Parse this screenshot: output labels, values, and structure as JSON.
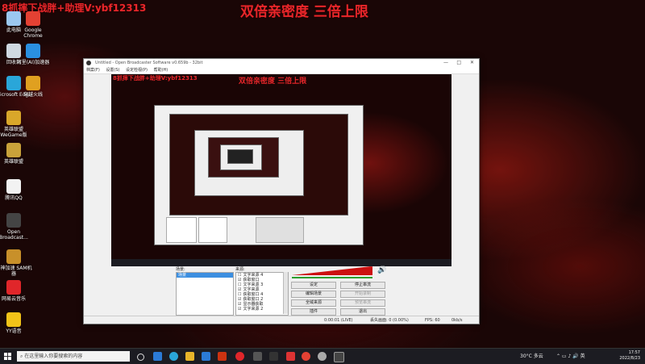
{
  "overlay": {
    "top_left": "8抓摔下战胖+助理V:ybf12313",
    "top_center": "双倍亲密度 三倍上限"
  },
  "desktop_icons": [
    {
      "label": "此电脑",
      "icon": "computer-icon",
      "color": "#9bc8f0"
    },
    {
      "label": "Google Chrome",
      "icon": "chrome-icon",
      "color": "#e34133"
    },
    {
      "label": "回收站",
      "icon": "recycle-bin-icon",
      "color": "#cfd8e0"
    },
    {
      "label": "阿里(AI)加速器",
      "icon": "accelerator-icon",
      "color": "#2a8fe0"
    },
    {
      "label": "Microsoft Edge",
      "icon": "edge-icon",
      "color": "#2aa6d9"
    },
    {
      "label": "穿越火线",
      "icon": "crossfire-icon",
      "color": "#e0a020"
    },
    {
      "label": "英雄联盟 WeGame版",
      "icon": "lol-wegame-icon",
      "color": "#d9a72a"
    },
    {
      "label": "英雄联盟",
      "icon": "lol-icon",
      "color": "#c9a23a"
    },
    {
      "label": "腾讯QQ",
      "icon": "qq-icon",
      "color": "#f2f2f2"
    },
    {
      "label": "Open Broadcast...",
      "icon": "obs-icon",
      "color": "#444444"
    },
    {
      "label": "雷神加速 SAM机器",
      "icon": "sam-icon",
      "color": "#c8902a"
    },
    {
      "label": "网易云音乐",
      "icon": "netease-music-icon",
      "color": "#e0262a"
    },
    {
      "label": "YY语音",
      "icon": "yy-icon",
      "color": "#f2c318"
    }
  ],
  "obs": {
    "title": "Untitled - Open Broadcaster Software v0.659b - 32bit",
    "menu": [
      "档案(F)",
      "设置(S)",
      "设定检视(P)",
      "帮助(H)"
    ],
    "window_controls": [
      "—",
      "□",
      "✕"
    ],
    "scenes_header": "场景:",
    "scene_item": "场景",
    "sources_header": "来源:",
    "sources": [
      {
        "label": "文字来源 4",
        "checked": false
      },
      {
        "label": "获取窗口",
        "checked": true
      },
      {
        "label": "文字来源 3",
        "checked": false
      },
      {
        "label": "文字来源",
        "checked": true
      },
      {
        "label": "获取窗口 4",
        "checked": false
      },
      {
        "label": "获取窗口 2",
        "checked": true
      },
      {
        "label": "显示器获取",
        "checked": true
      },
      {
        "label": "文字来源 2",
        "checked": true
      }
    ],
    "buttons_left": [
      "设定",
      "编辑场景",
      "全域来源",
      "插件"
    ],
    "buttons_right": [
      "停止串流",
      "",
      "",
      "退出"
    ],
    "buttons_right_disabled": [
      "",
      "开始录制",
      "预览串流",
      ""
    ],
    "status": {
      "time": "0:00:01 (LIVE)",
      "dropped": "丢失画面: 0 (0.00%)",
      "fps": "FPS: 60",
      "bitrate": "0kb/s"
    },
    "preview_overlay_left": "8抓摔下战胖+助理V:ybf12313",
    "preview_overlay_center": "双倍亲密度 三倍上限"
  },
  "taskbar": {
    "search_placeholder": "在这里输入你要搜索的内容",
    "weather": "30°C 多云",
    "time": "17:57",
    "date": "2022/8/23"
  },
  "colors": {
    "overlay_red": "#e8262a",
    "meter_red": "#cc1111",
    "meter_green": "#2e9e2e"
  }
}
